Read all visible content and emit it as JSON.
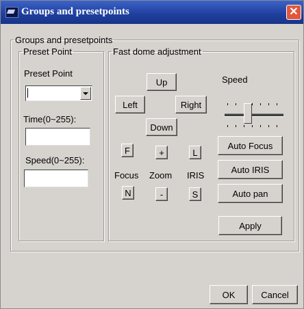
{
  "window": {
    "title": "Groups and presetpoints"
  },
  "outer_group": {
    "label": "Groups and presetpoints"
  },
  "preset_group": {
    "label": "Preset Point",
    "preset_label": "Preset Point",
    "preset_value": "",
    "time_label": "Time(0~255):",
    "time_value": "",
    "speed_label": "Speed(0~255):",
    "speed_value": ""
  },
  "dome_group": {
    "label": "Fast dome adjustment",
    "up": "Up",
    "left": "Left",
    "right": "Right",
    "down": "Down",
    "speed_label": "Speed",
    "speed_level": 0.4,
    "focus_far": "F",
    "zoom_in": "+",
    "iris_large": "L",
    "focus_label": "Focus",
    "zoom_label": "Zoom",
    "iris_label": "IRIS",
    "focus_near": "N",
    "zoom_out": "-",
    "iris_small": "S",
    "auto_focus": "Auto Focus",
    "auto_iris": "Auto IRIS",
    "auto_pan": "Auto pan"
  },
  "actions": {
    "apply": "Apply",
    "ok": "OK",
    "cancel": "Cancel"
  },
  "colors": {
    "titlebar": "#1e3f9c",
    "dialog_bg": "#d6d3ce",
    "close": "#e2573c"
  }
}
